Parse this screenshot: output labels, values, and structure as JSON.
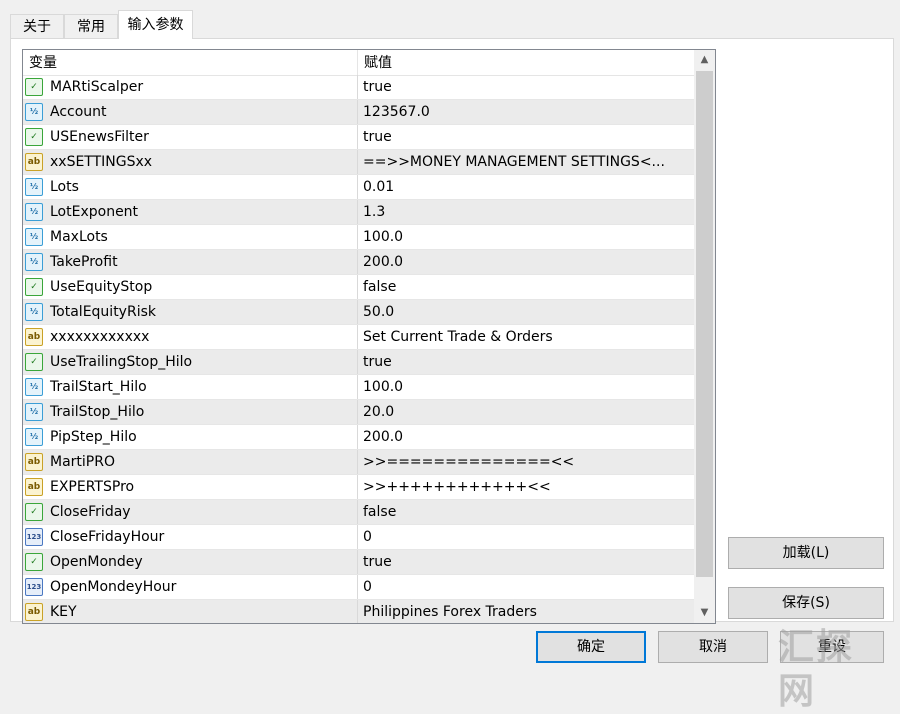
{
  "tabs": [
    {
      "label": "关于"
    },
    {
      "label": "常用"
    },
    {
      "label": "输入参数"
    }
  ],
  "grid": {
    "header": {
      "name": "变量",
      "value": "赋值"
    },
    "rows": [
      {
        "type": "bool",
        "icon": "bool-icon",
        "name": "MARtiScalper",
        "value": "true"
      },
      {
        "type": "double",
        "icon": "double-icon",
        "name": "Account",
        "value": "123567.0"
      },
      {
        "type": "bool",
        "icon": "bool-icon",
        "name": "USEnewsFilter",
        "value": "true"
      },
      {
        "type": "string",
        "icon": "string-icon",
        "name": "xxSETTINGSxx",
        "value": "==>>MONEY MANAGEMENT SETTINGS<..."
      },
      {
        "type": "double",
        "icon": "double-icon",
        "name": "Lots",
        "value": "0.01"
      },
      {
        "type": "double",
        "icon": "double-icon",
        "name": "LotExponent",
        "value": "1.3"
      },
      {
        "type": "double",
        "icon": "double-icon",
        "name": "MaxLots",
        "value": "100.0"
      },
      {
        "type": "double",
        "icon": "double-icon",
        "name": "TakeProfit",
        "value": "200.0"
      },
      {
        "type": "bool",
        "icon": "bool-icon",
        "name": "UseEquityStop",
        "value": "false"
      },
      {
        "type": "double",
        "icon": "double-icon",
        "name": "TotalEquityRisk",
        "value": "50.0"
      },
      {
        "type": "string",
        "icon": "string-icon",
        "name": "xxxxxxxxxxxx",
        "value": "Set Current Trade & Orders"
      },
      {
        "type": "bool",
        "icon": "bool-icon",
        "name": "UseTrailingStop_Hilo",
        "value": "true"
      },
      {
        "type": "double",
        "icon": "double-icon",
        "name": "TrailStart_Hilo",
        "value": "100.0"
      },
      {
        "type": "double",
        "icon": "double-icon",
        "name": "TrailStop_Hilo",
        "value": "20.0"
      },
      {
        "type": "double",
        "icon": "double-icon",
        "name": "PipStep_Hilo",
        "value": "200.0"
      },
      {
        "type": "string",
        "icon": "string-icon",
        "name": "MartiPRO",
        "value": ">>==============<<"
      },
      {
        "type": "string",
        "icon": "string-icon",
        "name": "EXPERTSPro",
        "value": ">>++++++++++++<<"
      },
      {
        "type": "bool",
        "icon": "bool-icon",
        "name": "CloseFriday",
        "value": "false"
      },
      {
        "type": "int",
        "icon": "int-icon",
        "name": "CloseFridayHour",
        "value": "0"
      },
      {
        "type": "bool",
        "icon": "bool-icon",
        "name": "OpenMondey",
        "value": "true"
      },
      {
        "type": "int",
        "icon": "int-icon",
        "name": "OpenMondeyHour",
        "value": "0"
      },
      {
        "type": "string",
        "icon": "string-icon",
        "name": "KEY",
        "value": "Philippines Forex Traders"
      }
    ]
  },
  "icon_glyphs": {
    "bool": "✓",
    "double": "½",
    "string": "ab",
    "int": "123"
  },
  "buttons": {
    "load": "加载(L)",
    "save": "保存(S)",
    "ok": "确定",
    "cancel": "取消",
    "reset": "重设"
  },
  "watermark": "汇探网",
  "colors": {
    "accent": "#0078d7",
    "alt_row": "#ebebeb"
  }
}
